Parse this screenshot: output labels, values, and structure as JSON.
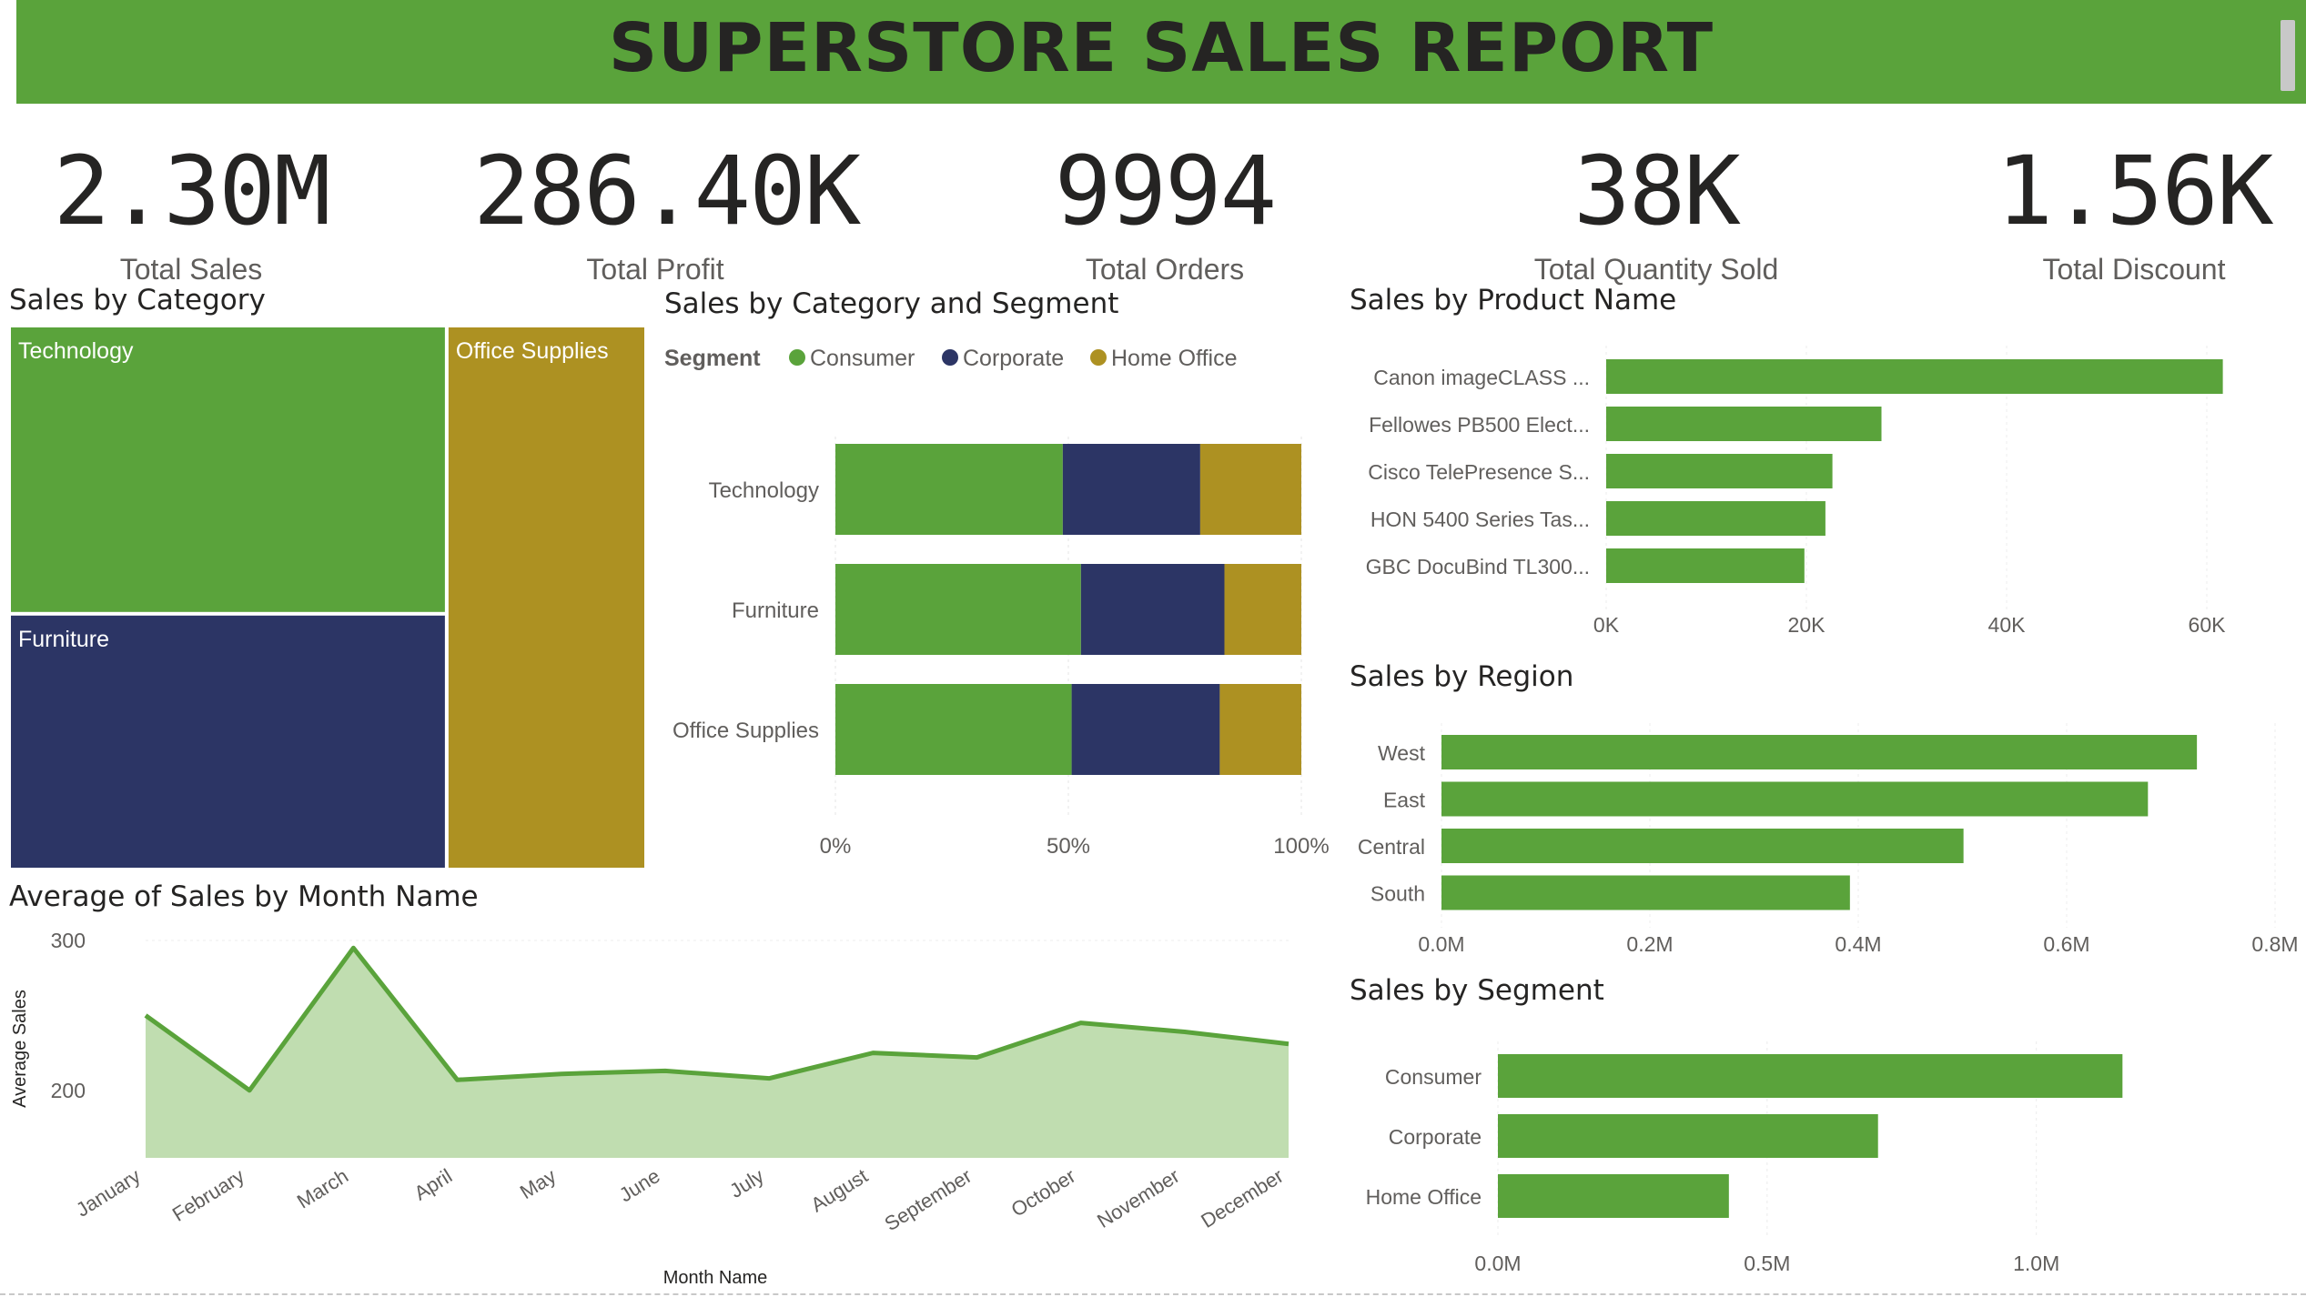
{
  "header": {
    "title": "SUPERSTORE SALES REPORT"
  },
  "kpis": [
    {
      "value": "2.30M",
      "label": "Total Sales"
    },
    {
      "value": "286.40K",
      "label": "Total Profit"
    },
    {
      "value": "9994",
      "label": "Total Orders"
    },
    {
      "value": "38K",
      "label": "Total Quantity Sold"
    },
    {
      "value": "1.56K",
      "label": "Total Discount"
    }
  ],
  "colors": {
    "consumer": "#5aa33b",
    "corporate": "#2c3565",
    "home_office": "#ad9122",
    "header": "#5aa33b",
    "area_fill": "#c0ddb0"
  },
  "chart_data": [
    {
      "type": "treemap",
      "title": "Sales by Category",
      "categories": [
        "Technology",
        "Furniture",
        "Office Supplies"
      ],
      "values": [
        836,
        742,
        719
      ]
    },
    {
      "type": "bar",
      "title": "Sales by Category and Segment",
      "legend_title": "Segment",
      "legend_position": "top-left",
      "stacked_percent": true,
      "categories": [
        "Technology",
        "Furniture",
        "Office Supplies"
      ],
      "series": [
        {
          "name": "Consumer",
          "values": [
            48.8,
            52.7,
            50.7
          ]
        },
        {
          "name": "Corporate",
          "values": [
            29.5,
            30.8,
            31.8
          ]
        },
        {
          "name": "Home Office",
          "values": [
            21.7,
            16.5,
            17.5
          ]
        }
      ],
      "xticks": [
        "0%",
        "50%",
        "100%"
      ],
      "xlim": [
        0,
        100
      ]
    },
    {
      "type": "bar",
      "title": "Sales by Product Name",
      "categories": [
        "Canon imageCLASS ...",
        "Fellowes PB500 Elect...",
        "Cisco TelePresence S...",
        "HON 5400 Series Tas...",
        "GBC DocuBind TL300..."
      ],
      "values": [
        61600,
        27500,
        22600,
        21900,
        19800
      ],
      "xticks": [
        "0K",
        "20K",
        "40K",
        "60K"
      ],
      "xlim": [
        0,
        65000
      ]
    },
    {
      "type": "bar",
      "title": "Sales by Region",
      "categories": [
        "West",
        "East",
        "Central",
        "South"
      ],
      "values": [
        725000,
        678000,
        501000,
        392000
      ],
      "xticks": [
        "0.0M",
        "0.2M",
        "0.4M",
        "0.6M",
        "0.8M"
      ],
      "xlim": [
        0,
        800000
      ]
    },
    {
      "type": "bar",
      "title": "Sales by Segment",
      "categories": [
        "Consumer",
        "Corporate",
        "Home Office"
      ],
      "values": [
        1160000,
        706000,
        429000
      ],
      "xticks": [
        "0.0M",
        "0.5M",
        "1.0M"
      ],
      "xlim": [
        0,
        1200000
      ]
    },
    {
      "type": "area",
      "title": "Average of Sales by Month Name",
      "xlabel": "Month Name",
      "ylabel": "Average Sales",
      "x": [
        "January",
        "February",
        "March",
        "April",
        "May",
        "June",
        "July",
        "August",
        "September",
        "October",
        "November",
        "December"
      ],
      "values": [
        250,
        200,
        295,
        207,
        211,
        213,
        208,
        225,
        222,
        245,
        239,
        231
      ],
      "yticks": [
        "200",
        "300"
      ],
      "ylim": [
        155,
        300
      ]
    }
  ]
}
